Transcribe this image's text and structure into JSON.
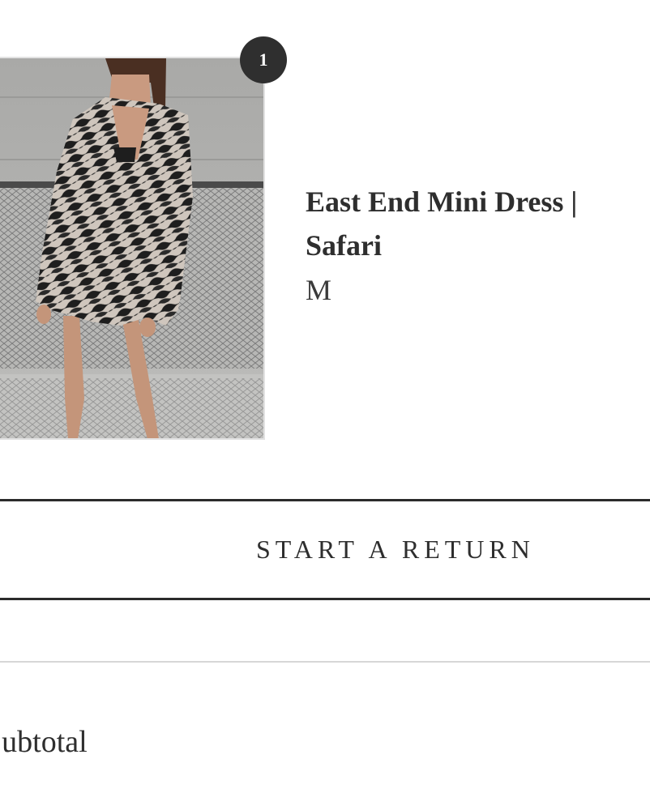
{
  "order_item": {
    "quantity": "1",
    "name": "East End Mini Dress | Safari",
    "variant": "M",
    "image_subject": "model wearing zebra print long-sleeve mini dress"
  },
  "actions": {
    "return_label": "START A RETURN"
  },
  "summary": {
    "subtotal_label": "Subtotal"
  },
  "colors": {
    "text": "#2e2e2e",
    "badge_bg": "#2f2f2f",
    "badge_text": "#ffffff",
    "rule_dark": "#2b2b2b",
    "rule_light": "#d7d7d7"
  }
}
